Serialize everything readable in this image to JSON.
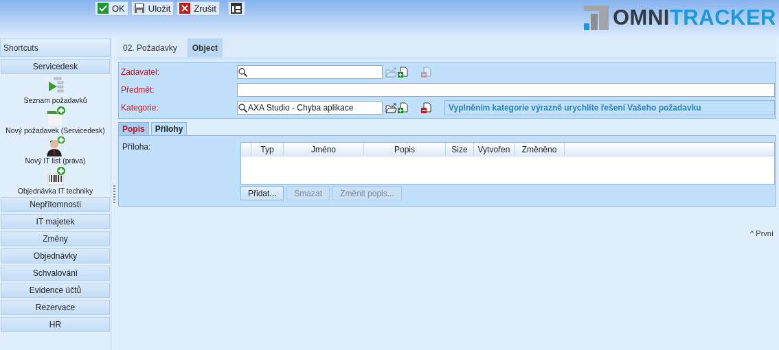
{
  "toolbar": {
    "buttons": [
      {
        "kind": "ok",
        "label": "OK"
      },
      {
        "kind": "save",
        "label": "Uložit"
      },
      {
        "kind": "cancel",
        "label": "Zrušit"
      },
      {
        "kind": "layout"
      }
    ]
  },
  "logo": {
    "text_1": "OMNI",
    "text_2": "TRACKER"
  },
  "sidebar": {
    "title": "Shortcuts",
    "groups": [
      {
        "label": "Servicedesk",
        "items": [
          {
            "kind": "list",
            "label": "Seznam požadavků"
          },
          {
            "kind": "new-doc",
            "label": "Nový požadavek (Servicedesk)"
          },
          {
            "kind": "person",
            "label": "Nový IT list (práva)"
          },
          {
            "kind": "barcode",
            "label": "Objednávka IT techniky"
          }
        ]
      },
      {
        "label": "Nepřítomnosti"
      },
      {
        "label": "IT majetek"
      },
      {
        "label": "Změny"
      },
      {
        "label": "Objednávky"
      },
      {
        "label": "Schvalování"
      },
      {
        "label": "Evidence účtů"
      },
      {
        "label": "Rezervace"
      },
      {
        "label": "HR"
      }
    ]
  },
  "tabs": [
    {
      "label": "02. Požadavky",
      "selected": false
    },
    {
      "label": "Object",
      "selected": true
    }
  ],
  "form": {
    "fields": [
      {
        "kind": "lookup",
        "label": "Zadavatel:",
        "required": true,
        "actions_enabled": false
      },
      {
        "kind": "text",
        "label": "Předmět:",
        "required": true
      },
      {
        "kind": "lookup",
        "label": "Kategorie:",
        "value": "AXA Studio - Chyba aplikace",
        "required": true,
        "actions_enabled": true,
        "hint": "Vyplněním kategorie výrazně urychlíte řešení Vašeho požadavku"
      }
    ]
  },
  "subtabs": [
    {
      "label": "Popis",
      "selected": false,
      "required": true
    },
    {
      "label": "Přílohy",
      "selected": true,
      "required": false
    }
  ],
  "attachments": {
    "label": "Příloha:",
    "columns": [
      "Typ",
      "Jméno",
      "Popis",
      "Size",
      "Vytvořen",
      "Změněno"
    ],
    "buttons": [
      {
        "label": "Přidat...",
        "disabled": false
      },
      {
        "label": "Smazat",
        "disabled": true
      },
      {
        "label": "Změnit popis...",
        "disabled": true
      }
    ]
  },
  "footer_link": "^ První"
}
